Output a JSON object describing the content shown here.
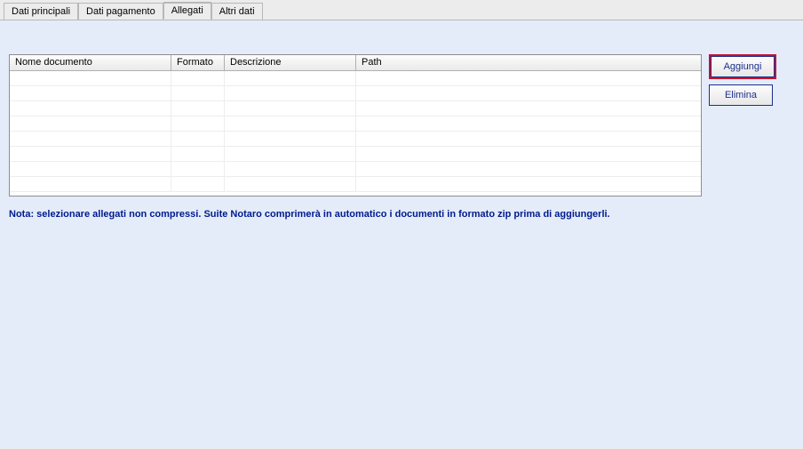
{
  "tabs": [
    {
      "label": "Dati principali",
      "active": false
    },
    {
      "label": "Dati pagamento",
      "active": false
    },
    {
      "label": "Allegati",
      "active": true
    },
    {
      "label": "Altri dati",
      "active": false
    }
  ],
  "grid": {
    "columns": {
      "nome": "Nome documento",
      "formato": "Formato",
      "descrizione": "Descrizione",
      "path": "Path"
    },
    "rows": []
  },
  "buttons": {
    "add": "Aggiungi",
    "delete": "Elimina"
  },
  "note": "Nota: selezionare allegati non compressi. Suite Notaro comprimerà in automatico i documenti in formato zip prima di aggiungerli."
}
